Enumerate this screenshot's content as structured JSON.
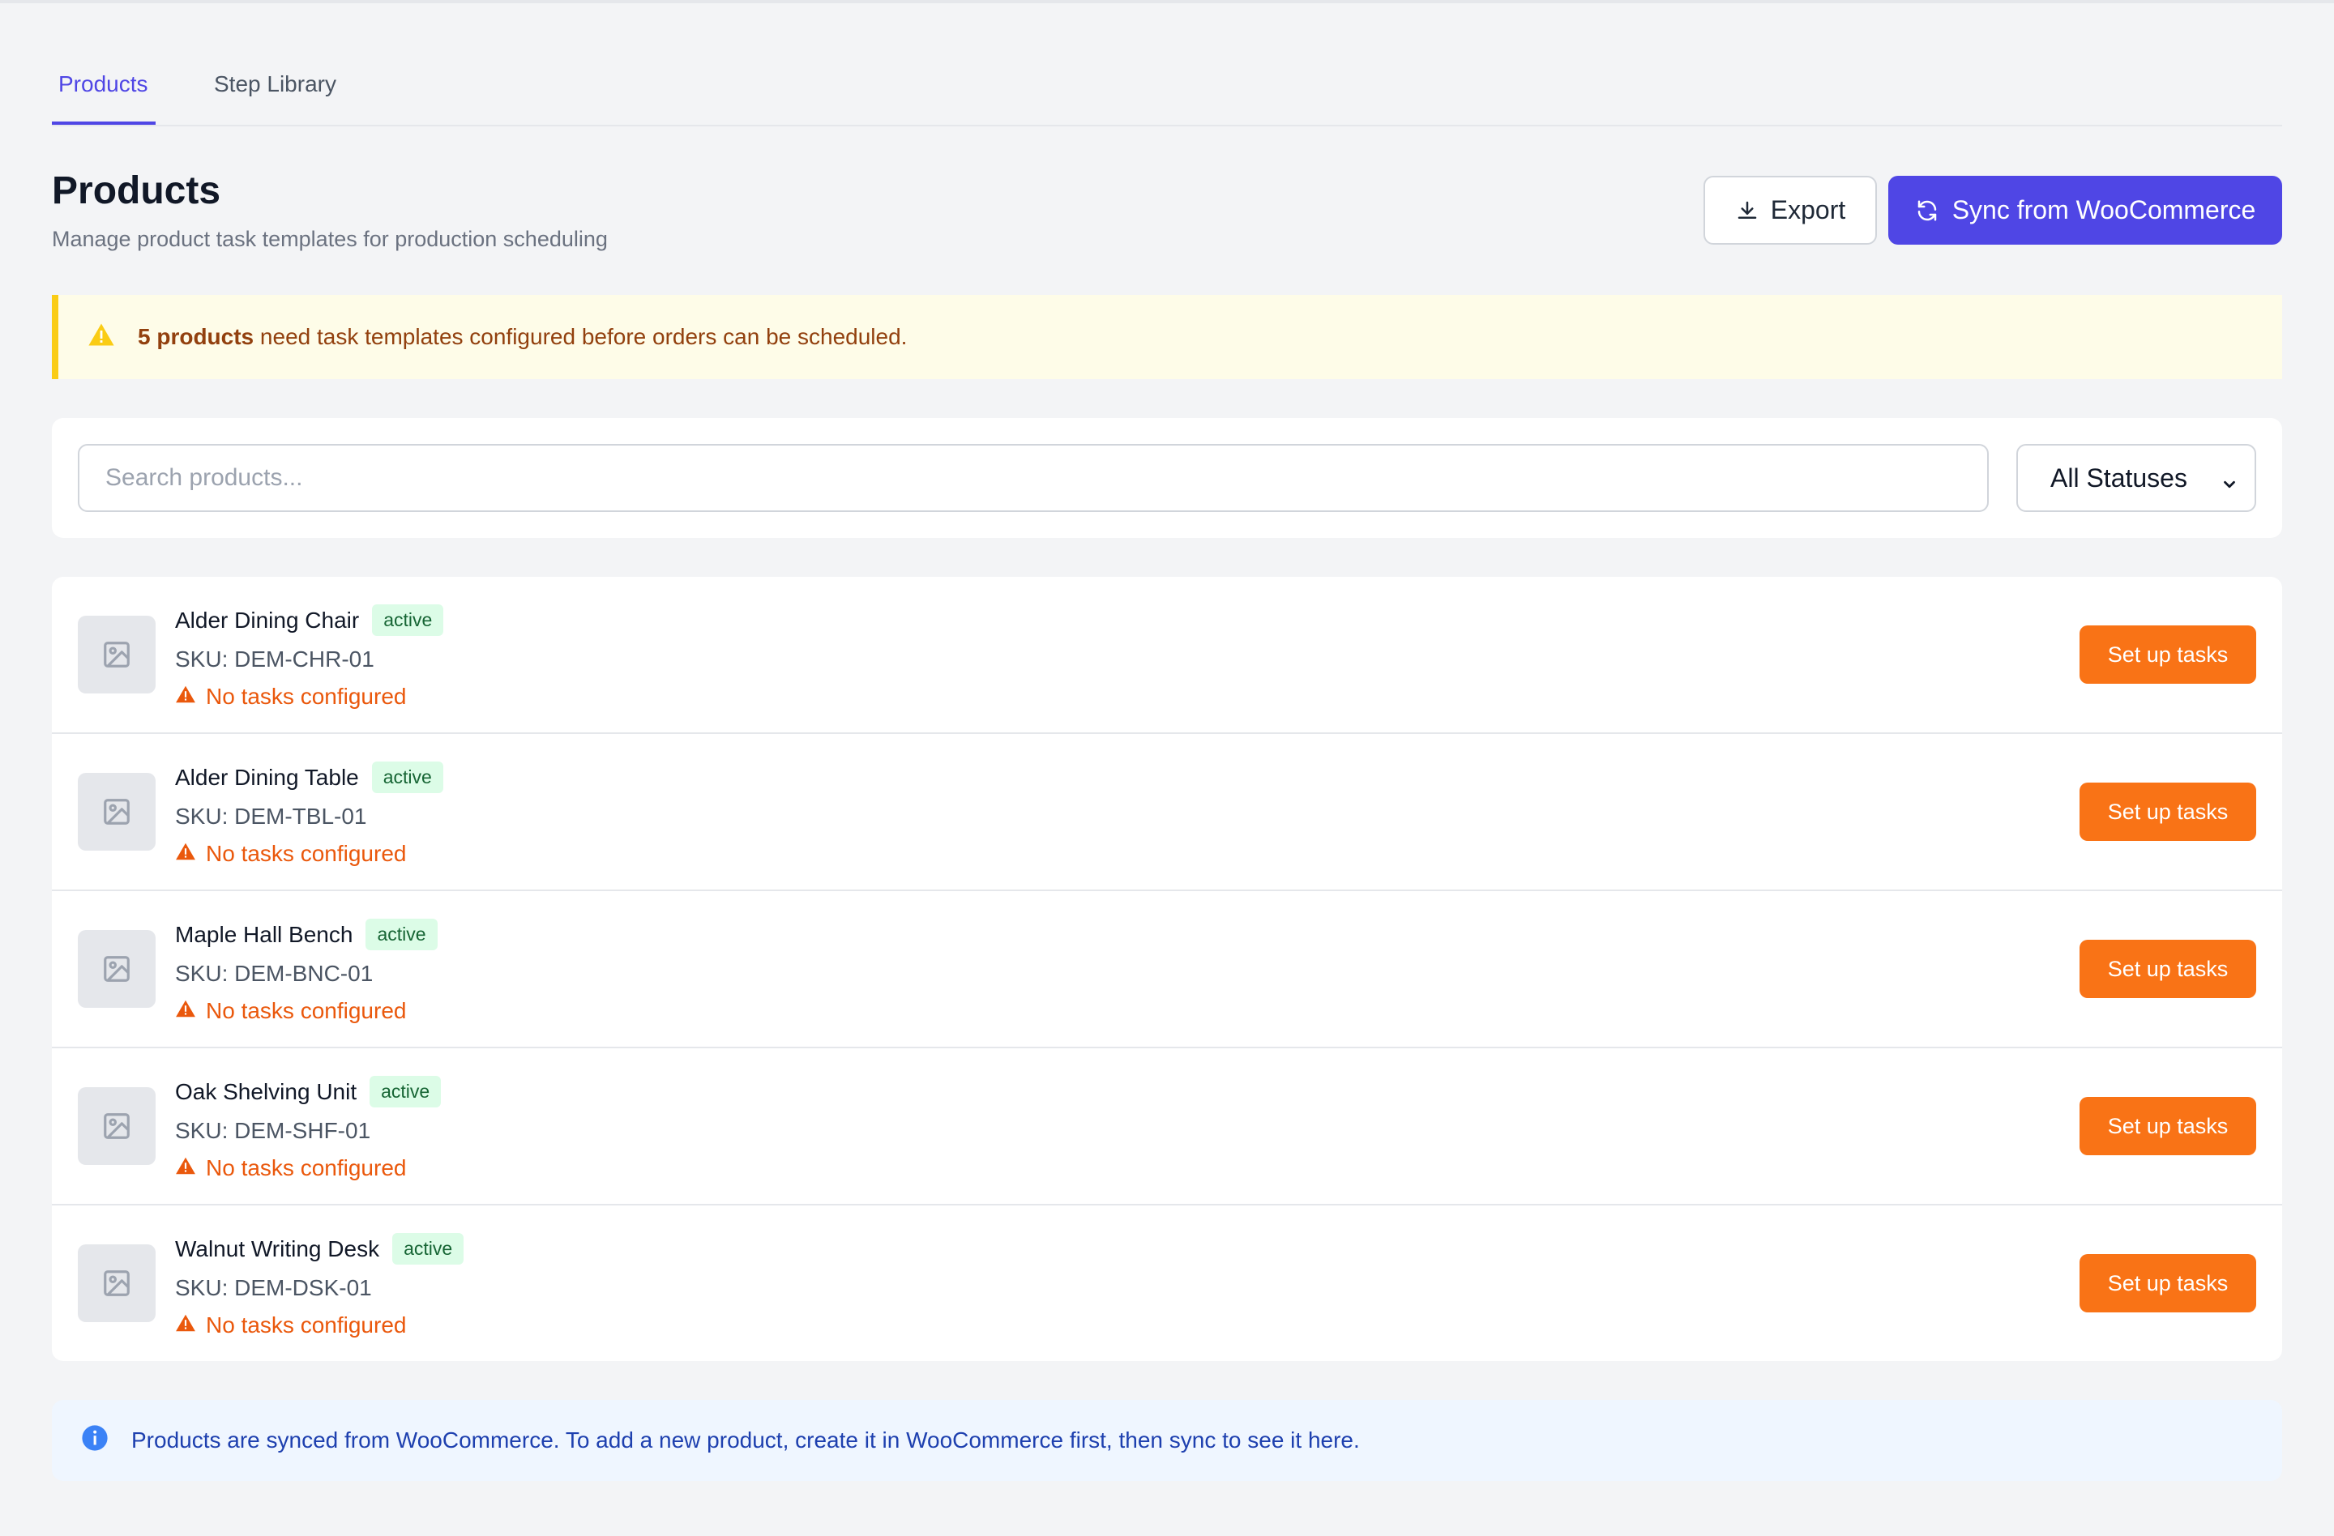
{
  "tabs": [
    {
      "label": "Products",
      "active": true
    },
    {
      "label": "Step Library",
      "active": false
    }
  ],
  "header": {
    "title": "Products",
    "subtitle": "Manage product task templates for production scheduling",
    "export_label": "Export",
    "sync_label": "Sync from WooCommerce"
  },
  "warning": {
    "count_text": "5 products",
    "message": " need task templates configured before orders can be scheduled."
  },
  "filters": {
    "search_placeholder": "Search products...",
    "search_value": "",
    "status_selected": "All Statuses"
  },
  "products": [
    {
      "name": "Alder Dining Chair",
      "status": "active",
      "sku": "SKU: DEM-CHR-01",
      "tasks_text": "No tasks configured",
      "action": "Set up tasks"
    },
    {
      "name": "Alder Dining Table",
      "status": "active",
      "sku": "SKU: DEM-TBL-01",
      "tasks_text": "No tasks configured",
      "action": "Set up tasks"
    },
    {
      "name": "Maple Hall Bench",
      "status": "active",
      "sku": "SKU: DEM-BNC-01",
      "tasks_text": "No tasks configured",
      "action": "Set up tasks"
    },
    {
      "name": "Oak Shelving Unit",
      "status": "active",
      "sku": "SKU: DEM-SHF-01",
      "tasks_text": "No tasks configured",
      "action": "Set up tasks"
    },
    {
      "name": "Walnut Writing Desk",
      "status": "active",
      "sku": "SKU: DEM-DSK-01",
      "tasks_text": "No tasks configured",
      "action": "Set up tasks"
    }
  ],
  "info": {
    "message": "Products are synced from WooCommerce. To add a new product, create it in WooCommerce first, then sync to see it here."
  },
  "colors": {
    "accent": "#4f46e5",
    "warning_border": "#facc15",
    "warning_bg": "#fefce8",
    "orange": "#f97316",
    "active_badge_bg": "#dcfce7",
    "info_bg": "#eff6ff"
  },
  "icons": {
    "export": "download-icon",
    "sync": "refresh-icon",
    "warning": "warning-triangle-icon",
    "thumb": "image-placeholder-icon",
    "info": "info-circle-icon",
    "select": "chevron-down-icon"
  }
}
